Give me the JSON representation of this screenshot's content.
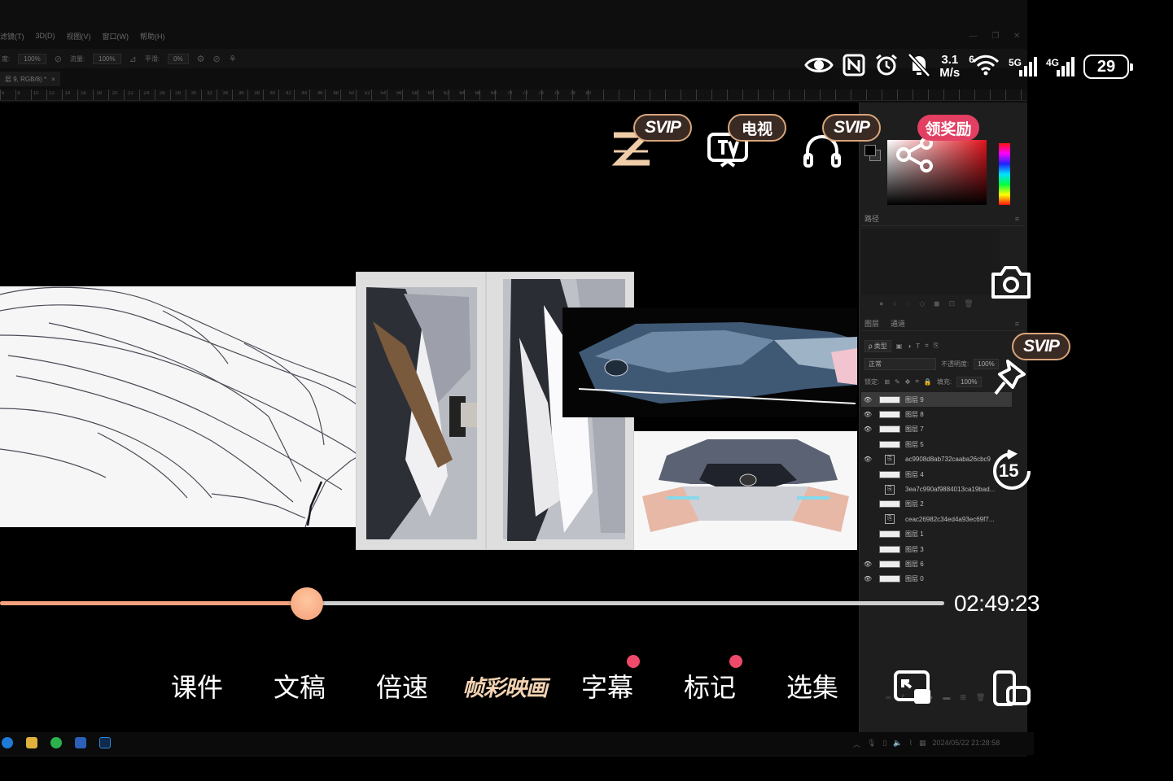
{
  "photoshop": {
    "menu": [
      "滤镜(T)",
      "3D(D)",
      "视图(V)",
      "窗口(W)",
      "帮助(H)"
    ],
    "options": {
      "opacity_label": "度:",
      "opacity": "100%",
      "flow_label": "流量:",
      "flow": "100%",
      "smooth_label": "平滑:",
      "smooth": "0%"
    },
    "doc_tab": "层 9, RGB/8) *",
    "doc_tab_close": "×",
    "ruler_numbers": [
      "6",
      "8",
      "10",
      "12",
      "14",
      "16",
      "18",
      "20",
      "22",
      "24",
      "26",
      "28",
      "30",
      "32",
      "34",
      "36",
      "38",
      "40",
      "42",
      "44",
      "46",
      "48",
      "50",
      "52",
      "54",
      "56",
      "58",
      "60",
      "62",
      "64",
      "66",
      "68",
      "70",
      "72",
      "74",
      "76",
      "78",
      "80"
    ],
    "paths_panel": {
      "title": "路径"
    },
    "layers_panel": {
      "tabs": [
        "图层",
        "通道"
      ],
      "filter": "ρ 类型",
      "blend_mode": "正常",
      "opacity_label": "不透明度:",
      "opacity": "100%",
      "lock_label": "锁定:",
      "fill_label": "填充:",
      "fill": "100%",
      "layers": [
        {
          "name": "图层 9",
          "visible": true,
          "smart": false,
          "active": true
        },
        {
          "name": "图层 8",
          "visible": true,
          "smart": false,
          "active": false
        },
        {
          "name": "图层 7",
          "visible": true,
          "smart": false,
          "active": false
        },
        {
          "name": "图层 5",
          "visible": false,
          "smart": false,
          "active": false
        },
        {
          "name": "ac9908d8ab732caaba26cbc9",
          "visible": true,
          "smart": true,
          "active": false
        },
        {
          "name": "图层 4",
          "visible": false,
          "smart": false,
          "active": false
        },
        {
          "name": "3ea7c990af9884013ca19bad...",
          "visible": false,
          "smart": true,
          "active": false
        },
        {
          "name": "图层 2",
          "visible": false,
          "smart": false,
          "active": false
        },
        {
          "name": "ceac26982c34ed4a93ec69f7...",
          "visible": false,
          "smart": true,
          "active": false
        },
        {
          "name": "图层 1",
          "visible": false,
          "smart": false,
          "active": false
        },
        {
          "name": "图层 3",
          "visible": false,
          "smart": false,
          "active": false
        },
        {
          "name": "图层 6",
          "visible": true,
          "smart": false,
          "active": false
        },
        {
          "name": "图层 0",
          "visible": true,
          "smart": false,
          "active": false
        }
      ]
    },
    "taskbar_datetime": "2024/05/22 21:28:58"
  },
  "status_bar": {
    "net_speed_value": "3.1",
    "net_speed_unit": "M/s",
    "wifi_label": "6",
    "sig1_label": "5G",
    "sig2_label": "4G",
    "battery": "29",
    "icons": [
      "eye-comfort-icon",
      "nfc-icon",
      "alarm-icon",
      "mute-icon",
      "wifi-icon",
      "signal-5g-icon",
      "signal-4g-icon",
      "battery-icon"
    ]
  },
  "top_bar": {
    "svip_label": "SVIP",
    "tv_label": "电视",
    "reward_label": "领奖励",
    "icons": [
      "zhihu-z-icon",
      "tv-cast-icon",
      "headphones-icon",
      "share-icon"
    ]
  },
  "side_controls": {
    "svip_label": "SVIP",
    "replay_seconds": "15",
    "icons": [
      "camera-icon",
      "pin-icon",
      "replay-15-icon"
    ]
  },
  "player": {
    "progress_fraction": 0.325,
    "time": "02:49:23",
    "colors": {
      "progress": "#f4a27e",
      "track": "#cfcfcf",
      "dot": "#f04a6b"
    }
  },
  "bottom_menu": {
    "items": [
      "课件",
      "文稿",
      "倍速",
      "帧彩映画",
      "字幕",
      "标记",
      "选集"
    ],
    "icons": [
      "picture-in-picture-icon",
      "rotate-device-icon"
    ]
  }
}
